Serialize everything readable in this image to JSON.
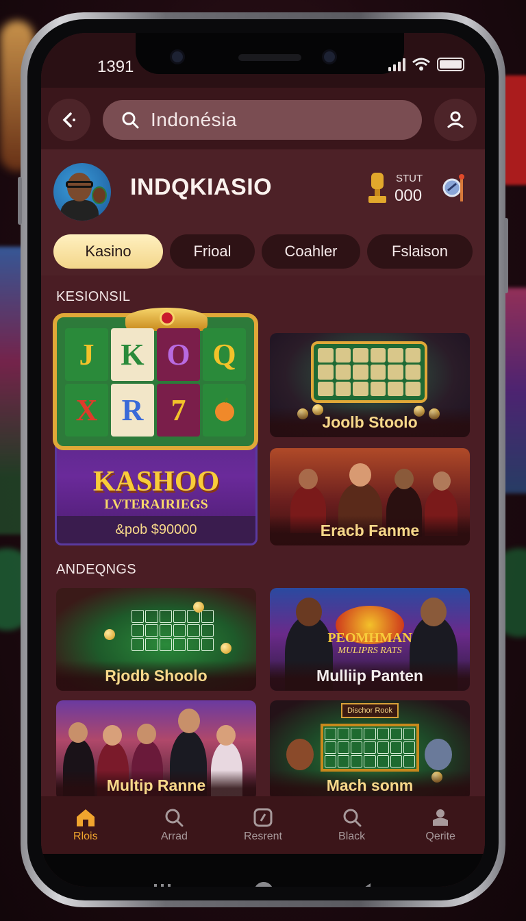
{
  "status_bar": {
    "time": "1391"
  },
  "header": {
    "search_value": "Indonésia",
    "back_icon": "back-arrow-icon",
    "profile_icon": "user-icon"
  },
  "profile": {
    "brand": "INDQKIASIO",
    "stat_label": "STUT",
    "stat_value": "000"
  },
  "tabs": [
    {
      "label": "Kasino",
      "active": true
    },
    {
      "label": "Frioal",
      "active": false
    },
    {
      "label": "Coahler",
      "active": false
    },
    {
      "label": "Fslaison",
      "active": false
    }
  ],
  "sections": {
    "first_title": "KESIONSIL",
    "second_title": "ANDEQNGS"
  },
  "featured": {
    "reels": [
      "J",
      "K",
      "O",
      "Q",
      "X",
      "R",
      "7",
      ""
    ],
    "title": "KASHOO",
    "subtitle": "LVTERAIRIEGS",
    "footer": "&pob $90000"
  },
  "cards": {
    "c1": "Joolb Stoolo",
    "c2": "Eracb Fanme",
    "c3": "Rjodb Shoolo",
    "c4_banner_1": "PEOMHMAN",
    "c4_banner_2": "MULIPRS RATS",
    "c4": "Mulliip Panten",
    "c5": "Multip Ranne",
    "c6_sign": "Dischor Rook",
    "c6": "Mach sonm"
  },
  "bottom_nav": [
    {
      "label": "Rlois",
      "icon": "home-icon",
      "active": true
    },
    {
      "label": "Arrad",
      "icon": "search-icon",
      "active": false
    },
    {
      "label": "Resrent",
      "icon": "recent-icon",
      "active": false
    },
    {
      "label": "Black",
      "icon": "search-icon",
      "active": false
    },
    {
      "label": "Qerite",
      "icon": "account-icon",
      "active": false
    }
  ],
  "colors": {
    "accent": "#f1a52e",
    "tab_active": "#f3d68a",
    "background": "#4a1d24"
  }
}
